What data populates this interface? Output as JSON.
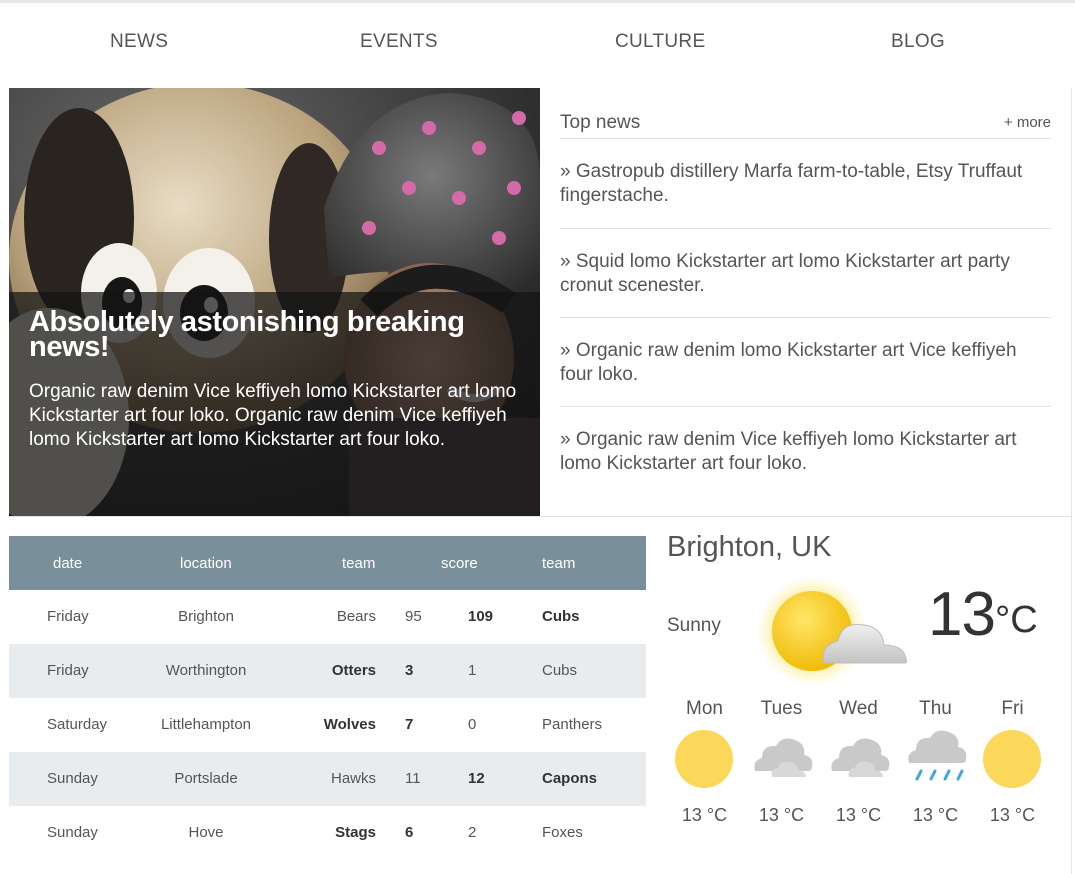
{
  "nav": {
    "items": [
      "NEWS",
      "EVENTS",
      "CULTURE",
      "BLOG"
    ]
  },
  "hero": {
    "title": "Absolutely astonishing breaking news!",
    "text": "Organic raw denim Vice keffiyeh lomo Kickstarter art lomo Kickstarter art four loko. Organic raw denim Vice keffiyeh lomo Kickstarter art lomo Kickstarter art four loko."
  },
  "top_news": {
    "title": "Top news",
    "more": "+ more",
    "items": [
      "» Gastropub distillery Marfa farm-to-table, Etsy Truffaut fingerstache.",
      "» Squid lomo Kickstarter art lomo Kickstarter art party cronut scenester.",
      "» Organic raw denim lomo Kickstarter art Vice keffiyeh four loko.",
      "» Organic raw denim Vice keffiyeh lomo Kickstarter art lomo Kickstarter art four loko."
    ]
  },
  "results": {
    "headers": [
      "date",
      "location",
      "team",
      "score",
      "team"
    ],
    "rows": [
      {
        "date": "Friday",
        "location": "Brighton",
        "home": "Bears",
        "home_score": "95",
        "away_score": "109",
        "away": "Cubs",
        "winner": "away"
      },
      {
        "date": "Friday",
        "location": "Worthington",
        "home": "Otters",
        "home_score": "3",
        "away_score": "1",
        "away": "Cubs",
        "winner": "home"
      },
      {
        "date": "Saturday",
        "location": "Littlehampton",
        "home": "Wolves",
        "home_score": "7",
        "away_score": "0",
        "away": "Panthers",
        "winner": "home"
      },
      {
        "date": "Sunday",
        "location": "Portslade",
        "home": "Hawks",
        "home_score": "11",
        "away_score": "12",
        "away": "Capons",
        "winner": "away"
      },
      {
        "date": "Sunday",
        "location": "Hove",
        "home": "Stags",
        "home_score": "6",
        "away_score": "2",
        "away": "Foxes",
        "winner": "home"
      }
    ]
  },
  "weather": {
    "city": "Brighton, UK",
    "condition": "Sunny",
    "condition_icon": "sun-cloud-icon",
    "temp": "13",
    "unit": "°C",
    "forecast": [
      {
        "day": "Mon",
        "icon": "sun-icon",
        "temp": "13 °C"
      },
      {
        "day": "Tues",
        "icon": "cloud-icon",
        "temp": "13 °C"
      },
      {
        "day": "Wed",
        "icon": "cloud-icon",
        "temp": "13 °C"
      },
      {
        "day": "Thu",
        "icon": "rain-icon",
        "temp": "13 °C"
      },
      {
        "day": "Fri",
        "icon": "sun-icon",
        "temp": "13 °C"
      }
    ]
  },
  "colors": {
    "table_header": "#79909b",
    "row_alt": "#e9ecef",
    "sun": "#fbd85a",
    "cloud": "#c9c9c9",
    "rain": "#3fa7e0"
  }
}
